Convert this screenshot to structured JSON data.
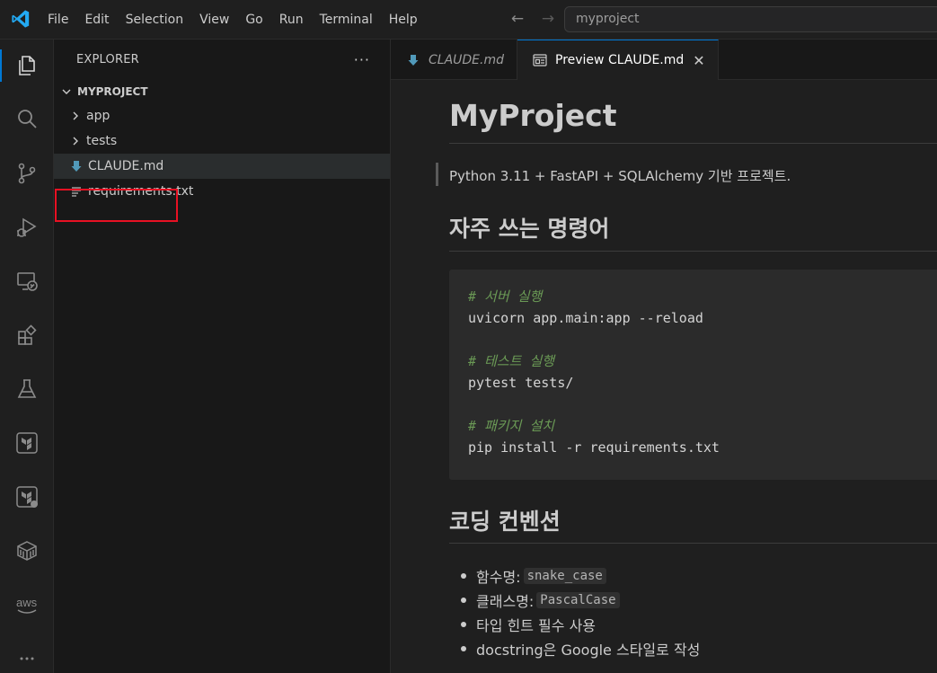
{
  "menu": [
    "File",
    "Edit",
    "Selection",
    "View",
    "Go",
    "Run",
    "Terminal",
    "Help"
  ],
  "search": {
    "text": "myproject"
  },
  "sidebar": {
    "title": "EXPLORER",
    "more": "···",
    "root": "MYPROJECT",
    "items": [
      {
        "label": "app",
        "kind": "folder"
      },
      {
        "label": "tests",
        "kind": "folder"
      },
      {
        "label": "CLAUDE.md",
        "kind": "markdown",
        "selected": true
      },
      {
        "label": "requirements.txt",
        "kind": "text"
      }
    ]
  },
  "tabs": [
    {
      "label": "CLAUDE.md",
      "active": false
    },
    {
      "label": "Preview CLAUDE.md",
      "active": true
    }
  ],
  "preview": {
    "h1": "MyProject",
    "quote": "Python 3.11 + FastAPI + SQLAlchemy 기반 프로젝트.",
    "h2_commands": "자주 쓰는 명령어",
    "code": [
      {
        "text": "# 서버 실행",
        "comment": true
      },
      {
        "text": "uvicorn app.main:app --reload",
        "comment": false
      },
      {
        "text": "",
        "comment": false
      },
      {
        "text": "# 테스트 실행",
        "comment": true
      },
      {
        "text": "pytest tests/",
        "comment": false
      },
      {
        "text": "",
        "comment": false
      },
      {
        "text": "# 패키지 설치",
        "comment": true
      },
      {
        "text": "pip install -r requirements.txt",
        "comment": false
      }
    ],
    "h2_conventions": "코딩 컨벤션",
    "bullets": [
      {
        "text": "함수명:",
        "code": "snake_case"
      },
      {
        "text": "클래스명:",
        "code": "PascalCase"
      },
      {
        "text": "타입 힌트 필수 사용",
        "code": ""
      },
      {
        "text": "docstring은 Google 스타일로 작성",
        "code": ""
      }
    ]
  },
  "colors": {
    "accent": "#0078d4",
    "highlight_box": "#e81123",
    "markdown_icon": "#519aba",
    "comment": "#6a9955"
  }
}
